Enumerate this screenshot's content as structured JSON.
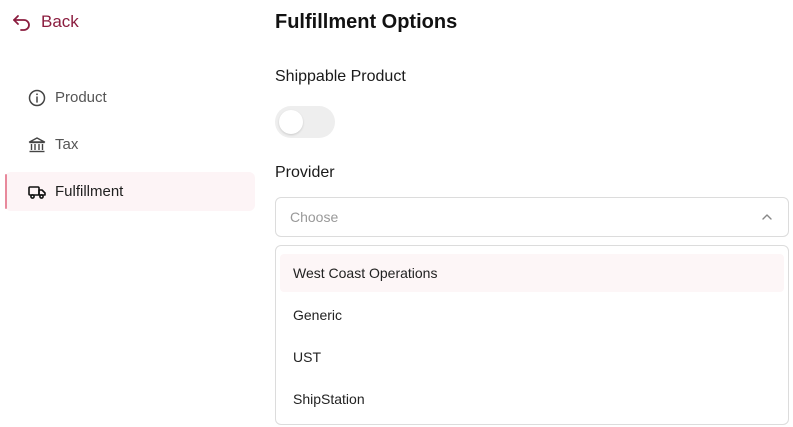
{
  "back": {
    "label": "Back",
    "icon": "undo-arrow-icon",
    "color": "#8b1d3f"
  },
  "sidebar": {
    "items": [
      {
        "label": "Product",
        "icon": "info-icon",
        "active": false
      },
      {
        "label": "Tax",
        "icon": "bank-icon",
        "active": false
      },
      {
        "label": "Fulfillment",
        "icon": "truck-icon",
        "active": true
      }
    ]
  },
  "main": {
    "title": "Fulfillment Options",
    "shippable": {
      "label": "Shippable Product",
      "enabled": false
    },
    "provider": {
      "label": "Provider",
      "placeholder": "Choose",
      "expanded": true,
      "options": [
        "West Coast Operations",
        "Generic",
        "UST",
        "ShipStation"
      ],
      "highlighted_index": 0
    }
  },
  "colors": {
    "accent": "#8b1d3f",
    "active_bg": "#fdf4f6",
    "active_bar": "#e8899c"
  }
}
